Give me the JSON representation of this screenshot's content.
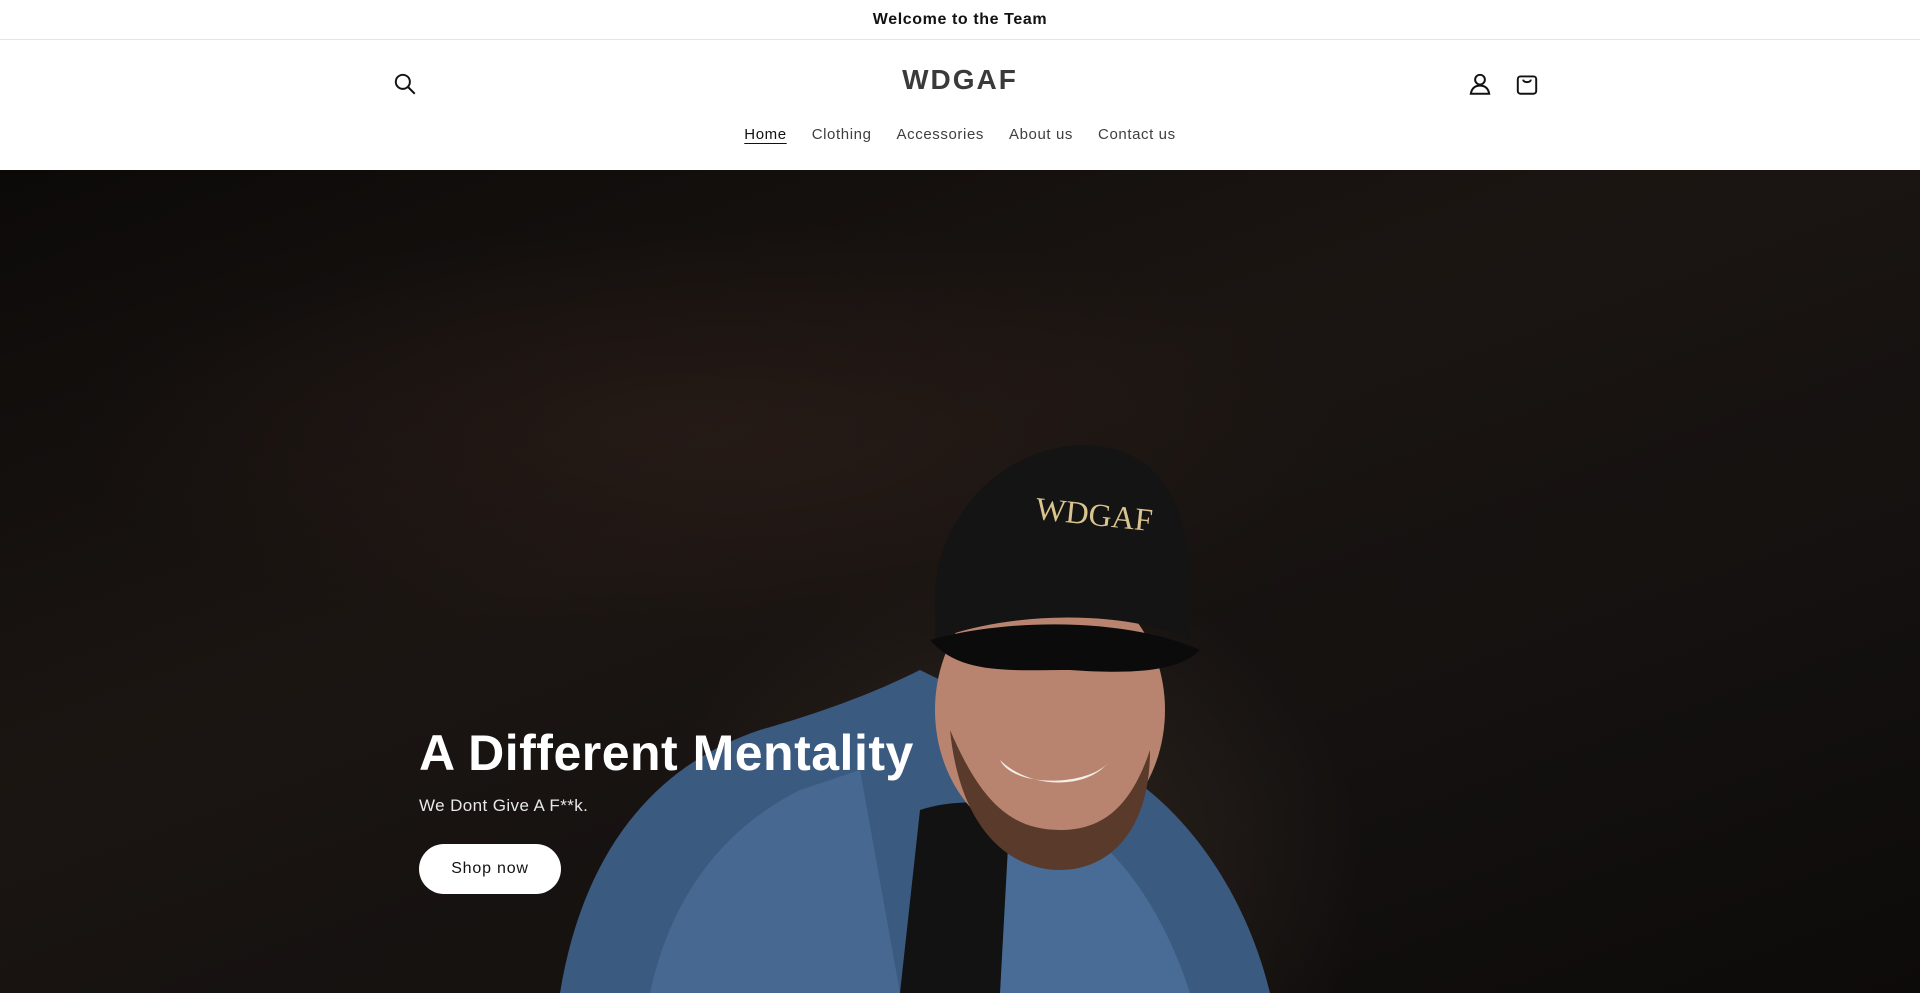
{
  "announcement": {
    "text": "Welcome to the Team"
  },
  "header": {
    "logo": "WDGAF",
    "icons": {
      "search": "search-icon",
      "account": "account-icon",
      "cart": "cart-icon"
    }
  },
  "nav": {
    "items": [
      {
        "label": "Home",
        "active": true
      },
      {
        "label": "Clothing",
        "active": false
      },
      {
        "label": "Accessories",
        "active": false
      },
      {
        "label": "About us",
        "active": false
      },
      {
        "label": "Contact us",
        "active": false
      }
    ]
  },
  "hero": {
    "title": "A Different Mentality",
    "subtitle": "We Dont Give A F**k.",
    "button_label": "Shop now",
    "cap_text": "WDGAF"
  },
  "colors": {
    "text": "#121212",
    "hero_bg": "#0f0c0b",
    "button_bg": "#ffffff"
  }
}
